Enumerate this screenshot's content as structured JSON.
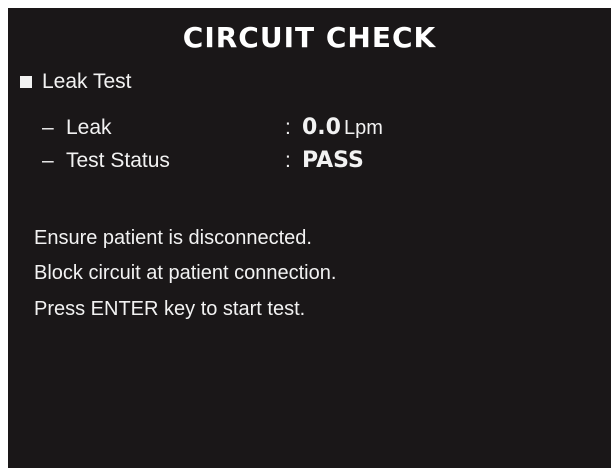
{
  "screen": {
    "title": "CIRCUIT CHECK"
  },
  "leak_test": {
    "section_label": "Leak Test",
    "leak": {
      "dash": "–",
      "label": "Leak",
      "colon": ":",
      "value": "0.0",
      "unit": "Lpm"
    },
    "status": {
      "dash": "–",
      "label": "Test Status",
      "colon": ":",
      "value": "PASS"
    }
  },
  "instructions": [
    "Ensure patient is disconnected.",
    "Block circuit at patient connection.",
    "Press ENTER key to start test."
  ],
  "colors": {
    "screen_background": "#1a1718",
    "text": "#f2f2f2"
  }
}
